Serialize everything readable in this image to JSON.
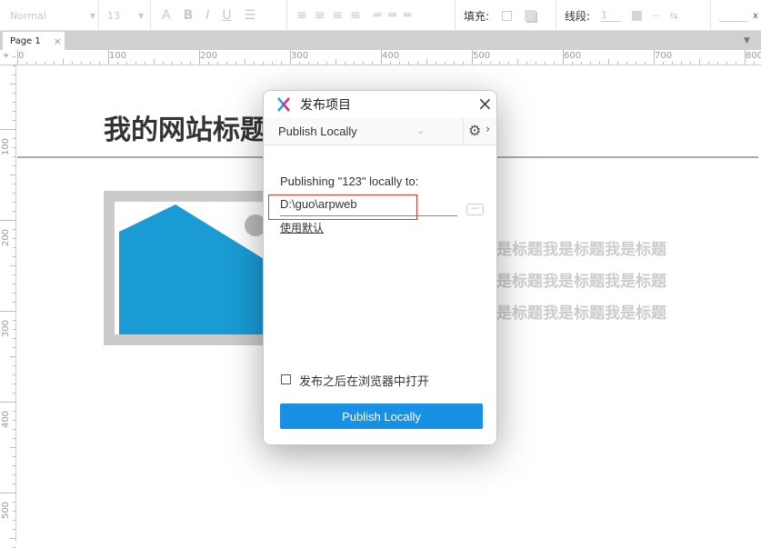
{
  "toolbar": {
    "style": "Normal",
    "font_size": "13",
    "fill_label": "填充:",
    "stroke_label": "线段:",
    "stroke_width": "1",
    "x_label": "x"
  },
  "tabs": [
    {
      "label": "Page 1",
      "close": "×"
    }
  ],
  "ruler": {
    "h": [
      "0",
      "100",
      "200",
      "300",
      "400",
      "500",
      "600",
      "700",
      "800"
    ],
    "v": [
      "100",
      "200",
      "300",
      "400",
      "500"
    ]
  },
  "canvas": {
    "heading": "我的网站标题",
    "text_lines": [
      "我是标题我是标题我是标题我是标题",
      "我是标题我是标题我是标题我是标题",
      "我是标题我是标题我是标题我是标题"
    ],
    "image_color": "#1a9bd4"
  },
  "dialog": {
    "title": "发布项目",
    "close": "×",
    "mode": "Publish Locally",
    "message": "Publishing \"123\" locally to:",
    "path": "D:\\guo\\arpweb",
    "browse": "···",
    "use_default": "使用默认",
    "open_after": "发布之后在浏览器中打开",
    "open_after_checked": false,
    "submit": "Publish Locally",
    "accent": "#1890e4"
  }
}
